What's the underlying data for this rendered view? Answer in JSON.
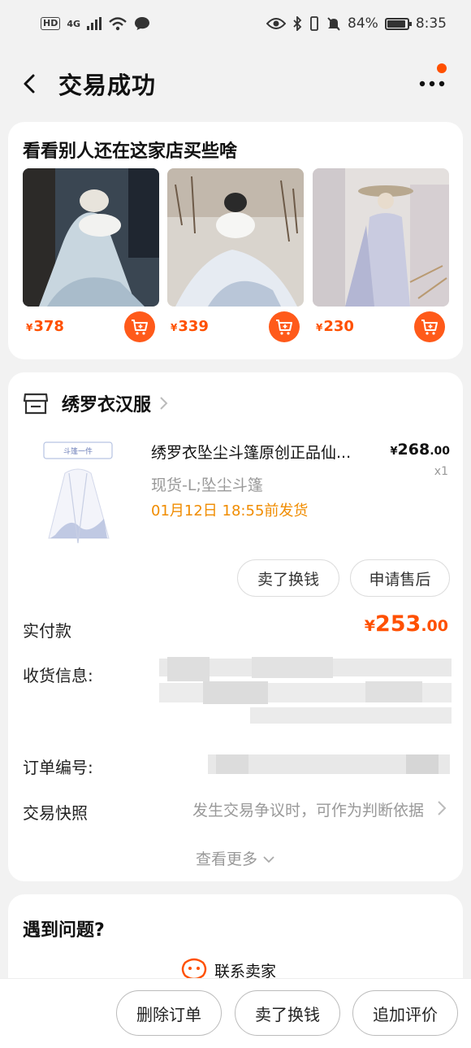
{
  "status_bar": {
    "hd": "HD",
    "network": "4G",
    "battery": "84%",
    "time": "8:35"
  },
  "nav": {
    "title": "交易成功"
  },
  "recommend": {
    "title": "看看别人还在这家店买些啥",
    "items": [
      {
        "currency": "¥",
        "price": "378"
      },
      {
        "currency": "¥",
        "price": "339"
      },
      {
        "currency": "¥",
        "price": "230"
      }
    ]
  },
  "order": {
    "shop_name": "绣罗衣汉服",
    "product": {
      "tag": "斗篷一件",
      "title": "绣罗衣坠尘斗篷原创正品仙...",
      "price_currency": "¥",
      "price_int": "268",
      "price_dec": ".00",
      "qty": "x1",
      "sku": "现货-L;坠尘斗篷",
      "ship": "01月12日 18:55前发货"
    },
    "buttons": {
      "resell": "卖了换钱",
      "after_sale": "申请售后"
    },
    "paid_label": "实付款",
    "paid_currency": "¥",
    "paid_int": "253",
    "paid_dec": ".00",
    "address_label": "收货信息:",
    "order_no_label": "订单编号:",
    "snapshot_label": "交易快照",
    "snapshot_text": "发生交易争议时，可作为判断依据",
    "see_more": "查看更多"
  },
  "help": {
    "title": "遇到问题?",
    "contact": "联系卖家"
  },
  "bottom": {
    "delete": "删除订单",
    "resell": "卖了换钱",
    "review": "追加评价"
  },
  "colors": {
    "accent": "#ff5000",
    "ship": "#f08c00"
  }
}
